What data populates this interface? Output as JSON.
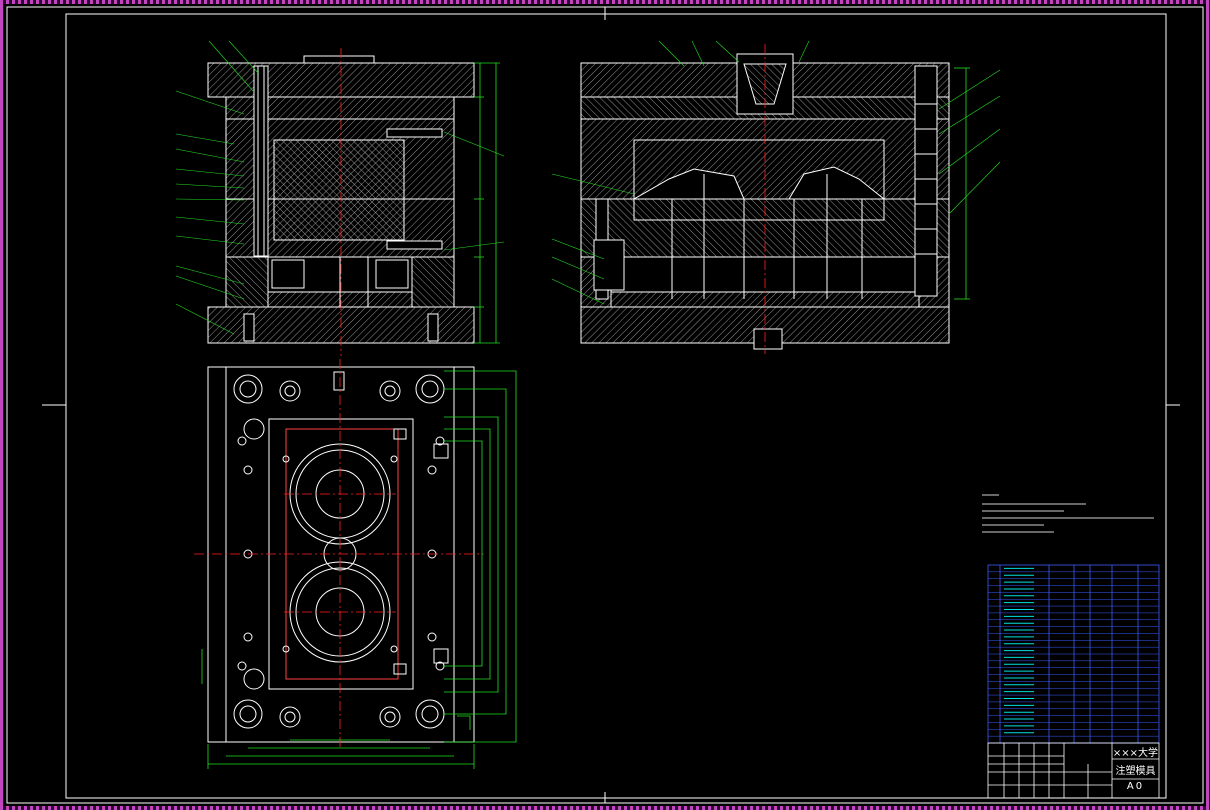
{
  "drawing": {
    "school": "×××大学",
    "title": "注塑模具",
    "sheet_size": "A0"
  },
  "colors": {
    "background": "#000000",
    "outline": "#ffffff",
    "hatch": "#c8c8c8",
    "dimension": "#22e022",
    "centerline": "#ff2020",
    "leader": "#22e022",
    "table": "#3a5dff",
    "table_text": "#00e0e0",
    "border_dash": "#c046c0"
  }
}
